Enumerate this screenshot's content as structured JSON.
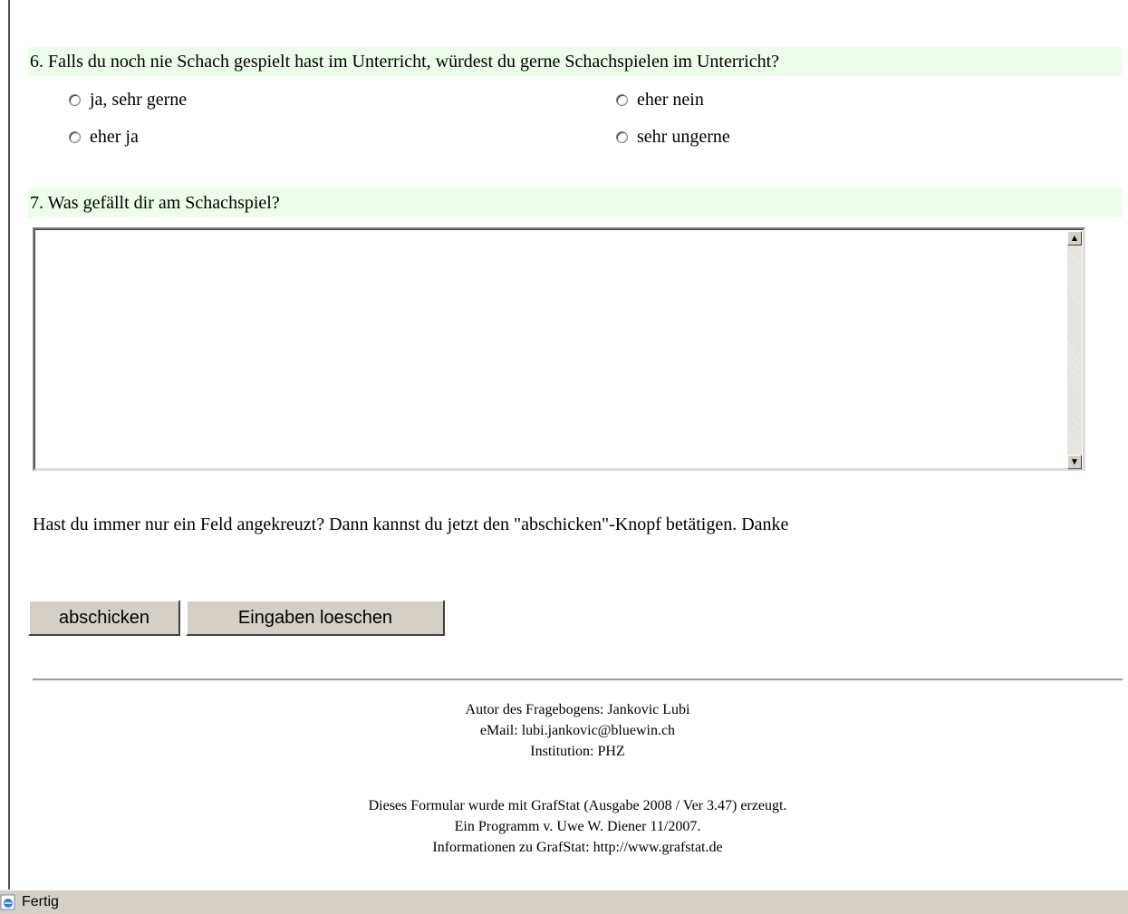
{
  "question6": {
    "label": "6. Falls du noch nie Schach gespielt hast im Unterricht, würdest du gerne Schachspielen im Unterricht?",
    "options": [
      "ja, sehr gerne",
      "eher ja",
      "eher nein",
      "sehr ungerne"
    ]
  },
  "question7": {
    "label": "7. Was gefällt dir am Schachspiel?",
    "answer": ""
  },
  "info": "Hast du immer nur ein Feld angekreuzt? Dann kannst du jetzt den \"abschicken\"-Knopf betätigen. Danke",
  "buttons": {
    "submit": "abschicken",
    "reset": "Eingaben loeschen"
  },
  "footer": {
    "author": "Autor des Fragebogens: Jankovic Lubi",
    "email": "eMail: lubi.jankovic@bluewin.ch",
    "institution": "Institution: PHZ",
    "generated": "Dieses Formular wurde mit GrafStat (Ausgabe 2008 / Ver 3.47) erzeugt.",
    "program": "Ein Programm v. Uwe W. Diener 11/2007.",
    "info_link": "Informationen zu GrafStat: http://www.grafstat.de"
  },
  "statusbar": {
    "text": "Fertig",
    "icon": "ie-page-icon"
  }
}
